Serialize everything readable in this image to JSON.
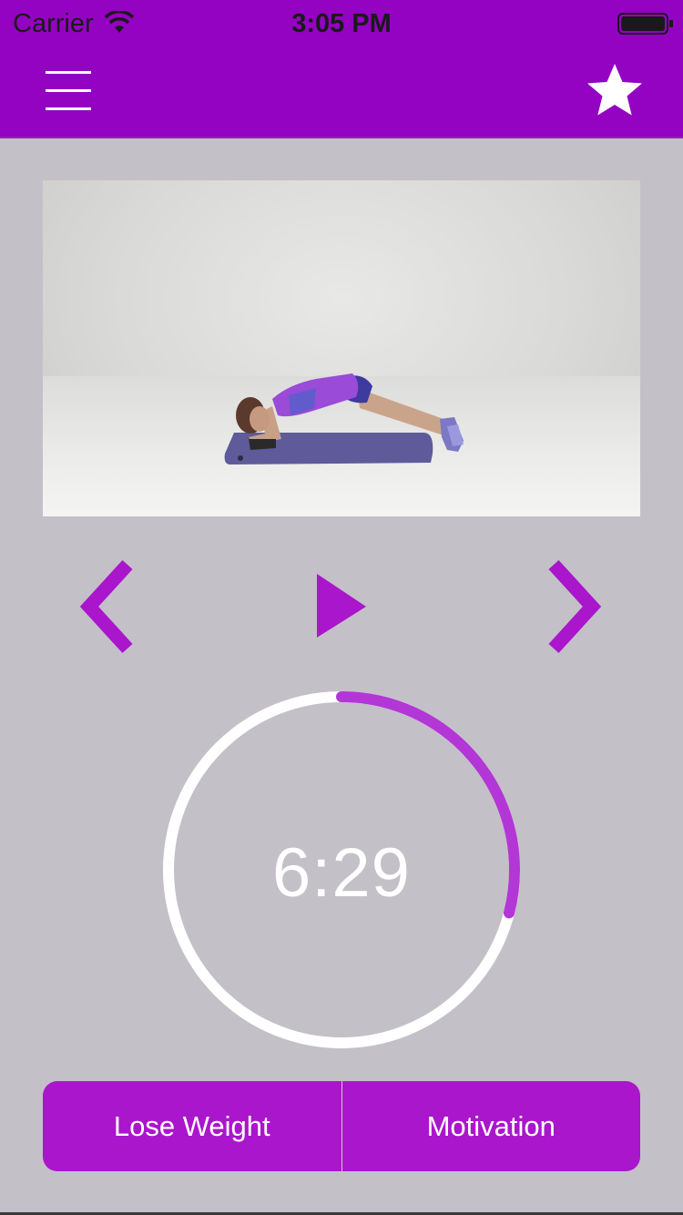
{
  "status_bar": {
    "carrier": "Carrier",
    "time": "3:05 PM",
    "wifi_icon": "wifi-icon",
    "battery_icon": "battery-icon"
  },
  "header": {
    "menu_icon": "hamburger-menu-icon",
    "favorite_icon": "star-icon"
  },
  "video": {
    "description_icon": "exercise-video"
  },
  "controls": {
    "previous_icon": "chevron-left-icon",
    "play_icon": "play-icon",
    "next_icon": "chevron-right-icon"
  },
  "timer": {
    "display": "6:29",
    "progress_fraction": 0.29
  },
  "bottom_buttons": {
    "left_label": "Lose Weight",
    "right_label": "Motivation"
  },
  "colors": {
    "header": "#9402c2",
    "accent": "#aa16cc",
    "background": "#c4c0c8",
    "timer_track": "#ffffff",
    "timer_progress": "#b336d6"
  }
}
